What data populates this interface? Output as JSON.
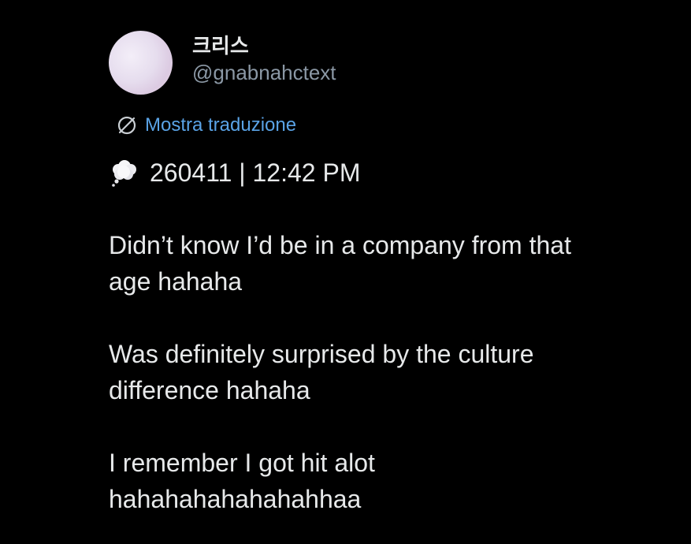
{
  "author": {
    "display_name": "크리스",
    "handle": "@gnabnahctext",
    "avatar_colors": [
      "#f3eef8",
      "#dccbe2"
    ]
  },
  "translate": {
    "label": "Mostra traduzione",
    "icon": "translate-globe-icon",
    "color": "#5aa3e6"
  },
  "post": {
    "prefix_icon": "thought-cloud-icon",
    "timestamp_text": "260411 | 12:42 PM",
    "paragraphs": [
      {
        "line1": "Didn’t know I’d be in a company from that",
        "line2": "age hahaha"
      },
      {
        "line1": "Was definitely surprised by the culture",
        "line2": "difference hahaha"
      },
      {
        "line1": "I remember I got hit alot",
        "line2": "hahahahahahahahhaa"
      }
    ]
  },
  "colors": {
    "background": "#000000",
    "text": "#e7e9ea",
    "secondary_text": "#8b98a5",
    "link": "#5aa3e6"
  }
}
